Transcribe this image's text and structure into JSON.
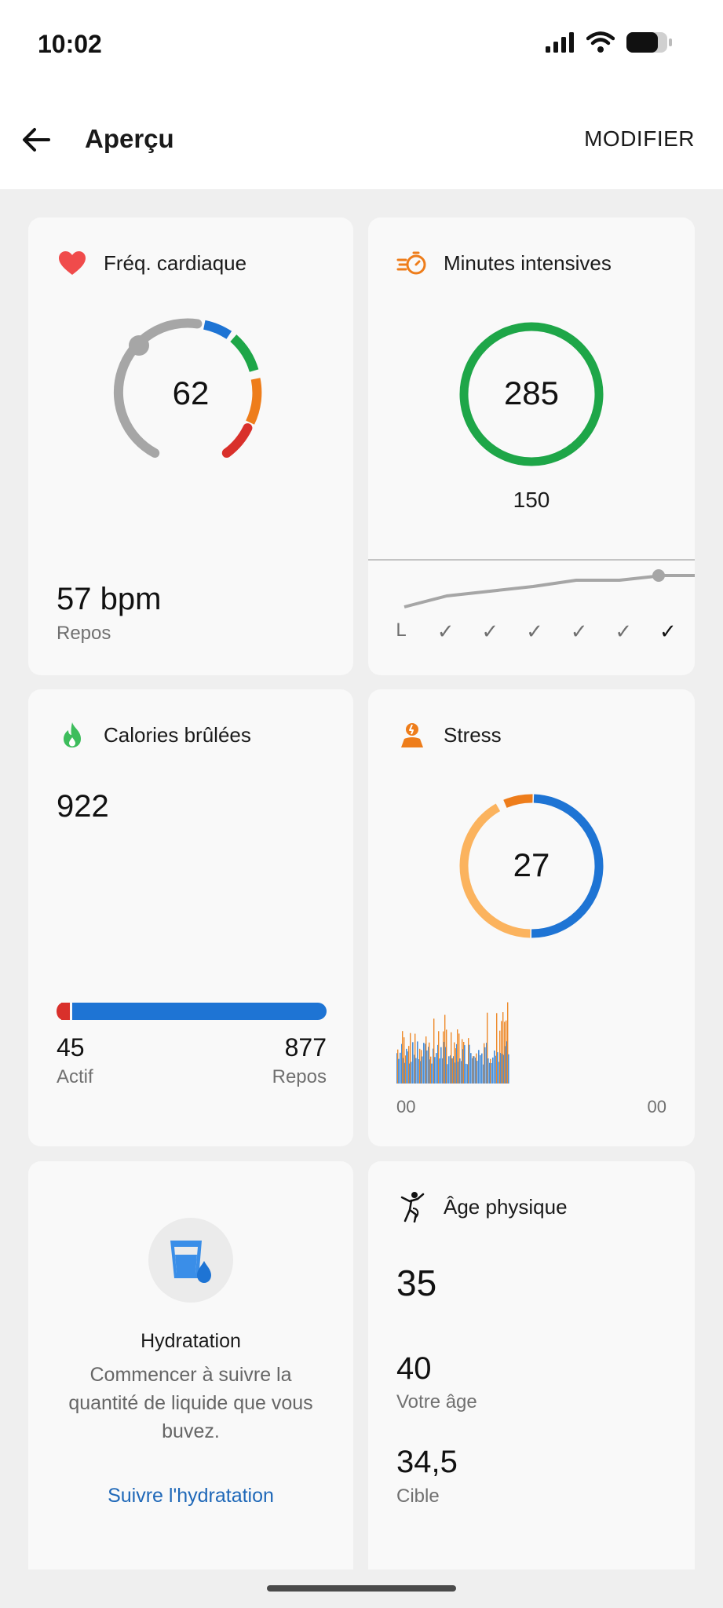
{
  "status_bar": {
    "time": "10:02"
  },
  "app_bar": {
    "title": "Aperçu",
    "action": "MODIFIER"
  },
  "colors": {
    "blue": "#1e74d4",
    "green": "#1ea648",
    "orange": "#ee7d1b",
    "red": "#d9302b",
    "light_orange": "#fbb35e",
    "grey": "#a6a6a6"
  },
  "heart_rate": {
    "label": "Fréq. cardiaque",
    "current": "62",
    "resting_value": "57 bpm",
    "resting_label": "Repos",
    "icon": "heart-icon"
  },
  "intense_minutes": {
    "label": "Minutes intensives",
    "value": "285",
    "goal": "150",
    "icon": "stopwatch-icon",
    "day_labels": [
      "L",
      "✓",
      "✓",
      "✓",
      "✓",
      "✓",
      "✓"
    ]
  },
  "calories": {
    "label": "Calories brûlées",
    "total": "922",
    "active_value": "45",
    "active_label": "Actif",
    "rest_value": "877",
    "rest_label": "Repos",
    "icon": "flame-icon"
  },
  "stress": {
    "label": "Stress",
    "value": "27",
    "axis_start": "00",
    "axis_end": "00",
    "icon": "stress-person-icon"
  },
  "hydration": {
    "title": "Hydratation",
    "description": "Commencer à suivre la quantité de liquide que vous buvez.",
    "link": "Suivre l'hydratation",
    "icon": "water-glass-icon"
  },
  "physical_age": {
    "label": "Âge physique",
    "value": "35",
    "your_age_value": "40",
    "your_age_label": "Votre âge",
    "target_value": "34,5",
    "target_label": "Cible",
    "icon": "fitness-figure-icon"
  }
}
